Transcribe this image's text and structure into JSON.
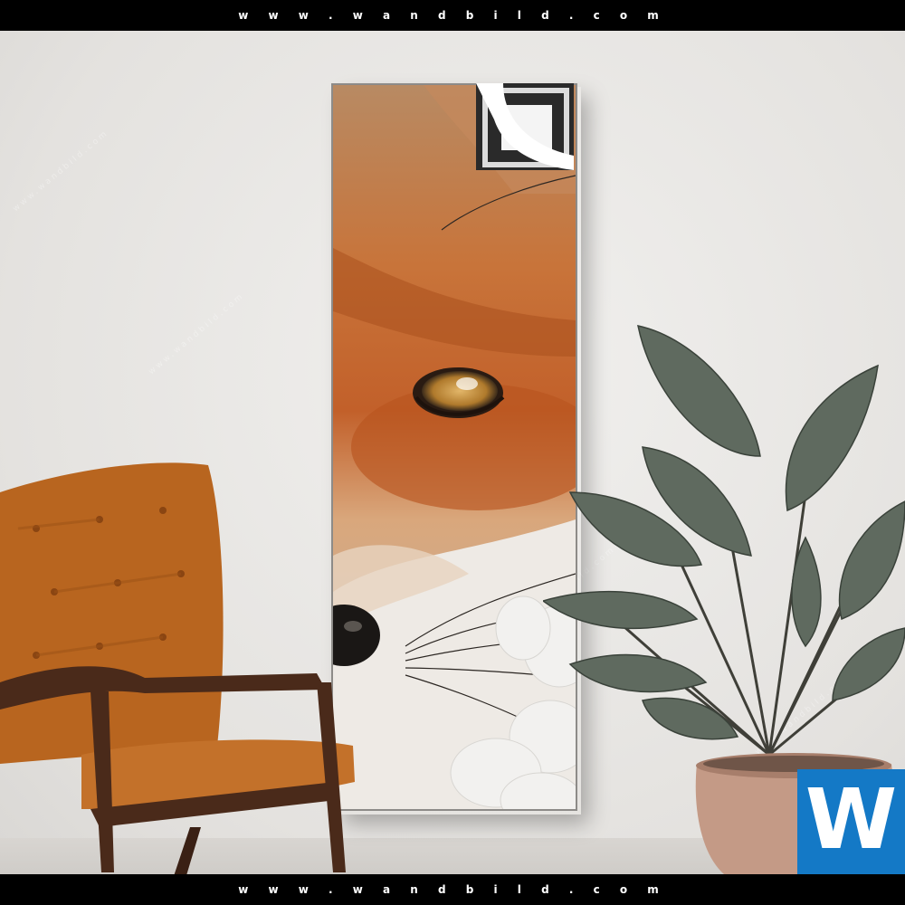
{
  "header": {
    "site": "w w w . w a n d b i l d . c o m"
  },
  "footer": {
    "site": "w w w . w a n d b i l d . c o m"
  },
  "logo": {
    "letter": "W",
    "color": "#1479c6"
  },
  "watermark": {
    "text": "www.wandbild.com"
  },
  "colors": {
    "wall": "#e9e7e5",
    "fox_orange": "#c2602a",
    "chair_orange": "#b8651f",
    "chair_wood": "#4a2a1a",
    "pot": "#c49a86",
    "leaf": "#5f6a5f"
  }
}
